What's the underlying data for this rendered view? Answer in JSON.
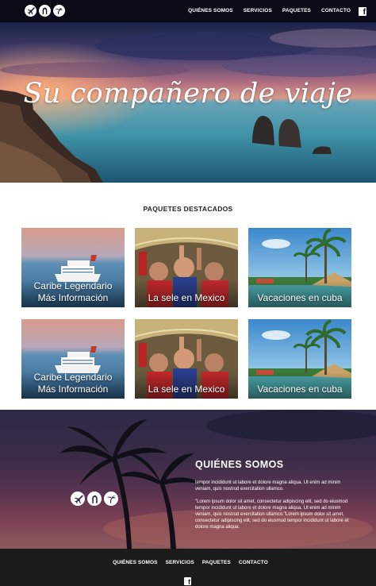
{
  "nav": {
    "logo_icons": [
      "airplane-icon",
      "horseshoe-icon",
      "palm-tree-icon"
    ],
    "links": [
      "QUIÉNES SOMOS",
      "SERVICIOS",
      "PAQUETES",
      "CONTACTO"
    ],
    "social_icon": "facebook-icon"
  },
  "hero": {
    "title": "Su compañero de viaje"
  },
  "packages": {
    "title": "PAQUETES DESTACADOS",
    "cards": [
      {
        "line1": "Caribe Legendario",
        "line2": "Más Información",
        "image": "cruise-ship"
      },
      {
        "line1": "La sele en Mexico",
        "line2": "",
        "image": "football-fans"
      },
      {
        "line1": "Vacaciones en cuba",
        "line2": "",
        "image": "tropical-beach"
      },
      {
        "line1": "Caribe Legendario",
        "line2": "Más Información",
        "image": "cruise-ship"
      },
      {
        "line1": "La sele en Mexico",
        "line2": "",
        "image": "football-fans"
      },
      {
        "line1": "Vacaciones en cuba",
        "line2": "",
        "image": "tropical-beach"
      }
    ]
  },
  "about": {
    "title": "QUIÉNES SOMOS",
    "paragraph1": "tempor incididunt ut labore et dolore magna aliqua. Ut enim ad minim veniam, quis nostrud exercitation ullamco.",
    "paragraph2": "\"Lorem ipsum dolor sit amet, consectetur adipiscing elit, sed do eiusmod tempor incididunt ut labore et dolore magna aliqua. Ut enim ad minim veniam, quis nostrud exercitation ullamco.\"Lorem ipsum dolor sit amet, consectetur adipiscing elit, sed do eiusmod tempor incididunt ut labore et dolore magna aliqua."
  },
  "footer": {
    "links": [
      "QUIÉNES SOMOS",
      "SERVICIOS",
      "PAQUETES",
      "CONTACTO"
    ],
    "social_icon": "facebook-icon"
  },
  "colors": {
    "nav_bg": "#0b0b18",
    "footer_bg": "#1b1b1b",
    "text_light": "#ffffff"
  }
}
